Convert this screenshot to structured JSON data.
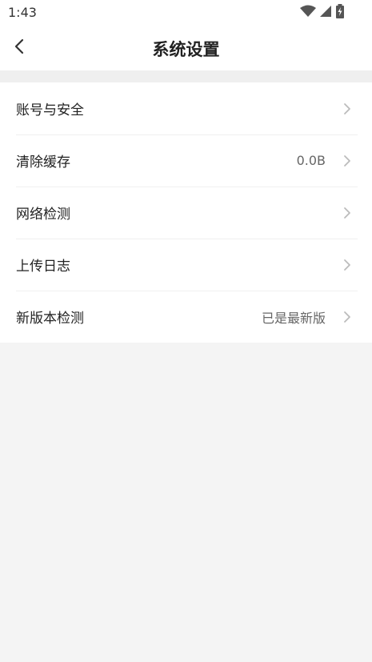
{
  "status_bar": {
    "time": "1:43",
    "icons": [
      "wifi-icon",
      "signal-icon",
      "battery-charging-icon"
    ]
  },
  "header": {
    "title": "系统设置",
    "back_icon": "chevron-left-icon"
  },
  "settings": {
    "items": [
      {
        "label": "账号与安全",
        "value": ""
      },
      {
        "label": "清除缓存",
        "value": "0.0B"
      },
      {
        "label": "网络检测",
        "value": ""
      },
      {
        "label": "上传日志",
        "value": ""
      },
      {
        "label": "新版本检测",
        "value": "已是最新版"
      }
    ]
  },
  "colors": {
    "background": "#f4f4f4",
    "surface": "#ffffff",
    "text_primary": "#222222",
    "text_secondary": "#666666",
    "chevron": "#bbbbbb"
  }
}
